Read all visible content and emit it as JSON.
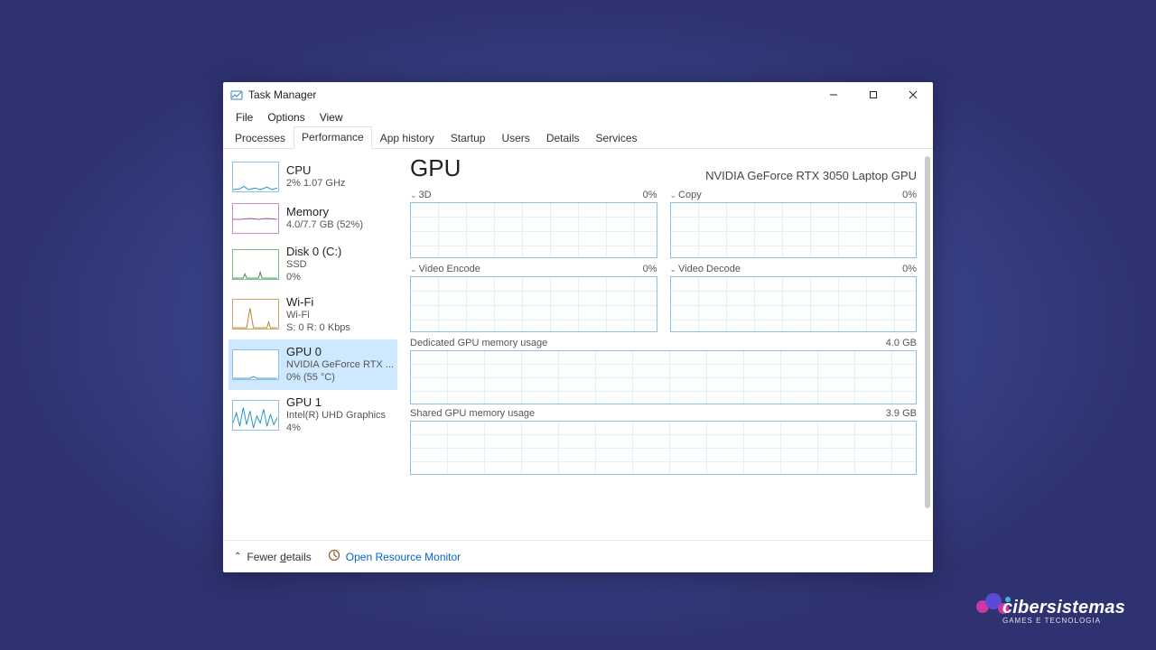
{
  "window": {
    "title": "Task Manager"
  },
  "menubar": [
    "File",
    "Options",
    "View"
  ],
  "tabs": [
    "Processes",
    "Performance",
    "App history",
    "Startup",
    "Users",
    "Details",
    "Services"
  ],
  "active_tab_index": 1,
  "sidebar": [
    {
      "title": "CPU",
      "sub": "2%  1.07 GHz",
      "sub2": ""
    },
    {
      "title": "Memory",
      "sub": "4.0/7.7 GB (52%)",
      "sub2": ""
    },
    {
      "title": "Disk 0 (C:)",
      "sub": "SSD",
      "sub2": "0%"
    },
    {
      "title": "Wi-Fi",
      "sub": "Wi-Fi",
      "sub2": "S: 0  R: 0 Kbps"
    },
    {
      "title": "GPU 0",
      "sub": "NVIDIA GeForce RTX ...",
      "sub2": "0%  (55 °C)"
    },
    {
      "title": "GPU 1",
      "sub": "Intel(R) UHD Graphics",
      "sub2": "4%"
    }
  ],
  "selected_sidebar_index": 4,
  "main": {
    "title": "GPU",
    "subtitle": "NVIDIA GeForce RTX 3050 Laptop GPU",
    "mini_graphs": [
      {
        "label": "3D",
        "value": "0%"
      },
      {
        "label": "Copy",
        "value": "0%"
      },
      {
        "label": "Video Encode",
        "value": "0%"
      },
      {
        "label": "Video Decode",
        "value": "0%"
      }
    ],
    "big_graphs": [
      {
        "label": "Dedicated GPU memory usage",
        "right": "4.0 GB"
      },
      {
        "label": "Shared GPU memory usage",
        "right": "3.9 GB"
      }
    ]
  },
  "footer": {
    "fewer_details": "Fewer details",
    "open_resmon": "Open Resource Monitor"
  },
  "brand": {
    "name": "cibersistemas",
    "tagline": "GAMES E TECNOLOGIA"
  }
}
